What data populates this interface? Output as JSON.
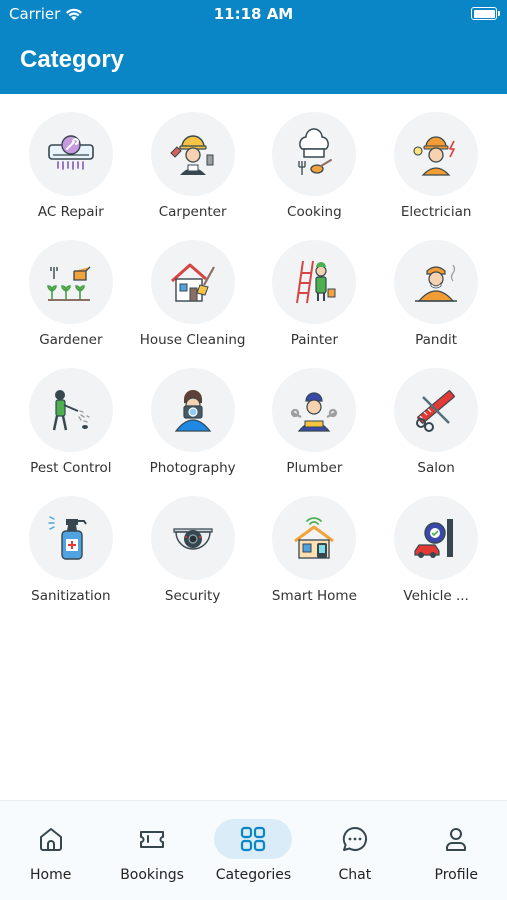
{
  "status_bar": {
    "carrier": "Carrier",
    "time": "11:18 AM"
  },
  "header": {
    "title": "Category"
  },
  "categories": [
    {
      "label": "AC Repair",
      "icon": "ac-repair-icon"
    },
    {
      "label": "Carpenter",
      "icon": "carpenter-icon"
    },
    {
      "label": "Cooking",
      "icon": "cooking-icon"
    },
    {
      "label": "Electrician",
      "icon": "electrician-icon"
    },
    {
      "label": "Gardener",
      "icon": "gardener-icon"
    },
    {
      "label": "House Cleaning",
      "icon": "house-cleaning-icon"
    },
    {
      "label": "Painter",
      "icon": "painter-icon"
    },
    {
      "label": "Pandit",
      "icon": "pandit-icon"
    },
    {
      "label": "Pest Control",
      "icon": "pest-control-icon"
    },
    {
      "label": "Photography",
      "icon": "photography-icon"
    },
    {
      "label": "Plumber",
      "icon": "plumber-icon"
    },
    {
      "label": "Salon",
      "icon": "salon-icon"
    },
    {
      "label": "Sanitization",
      "icon": "sanitization-icon"
    },
    {
      "label": "Security",
      "icon": "security-camera-icon"
    },
    {
      "label": "Smart Home",
      "icon": "smart-home-icon"
    },
    {
      "label": "Vehicle ...",
      "icon": "vehicle-service-icon"
    }
  ],
  "tabbar": {
    "items": [
      {
        "label": "Home",
        "icon": "home-icon"
      },
      {
        "label": "Bookings",
        "icon": "ticket-icon"
      },
      {
        "label": "Categories",
        "icon": "grid-icon",
        "active": true
      },
      {
        "label": "Chat",
        "icon": "chat-bubble-icon"
      },
      {
        "label": "Profile",
        "icon": "person-icon"
      }
    ]
  },
  "colors": {
    "primary": "#0a85c6",
    "tile_bg": "#f1f3f4",
    "active_tab_bg": "#d9ecf8"
  }
}
